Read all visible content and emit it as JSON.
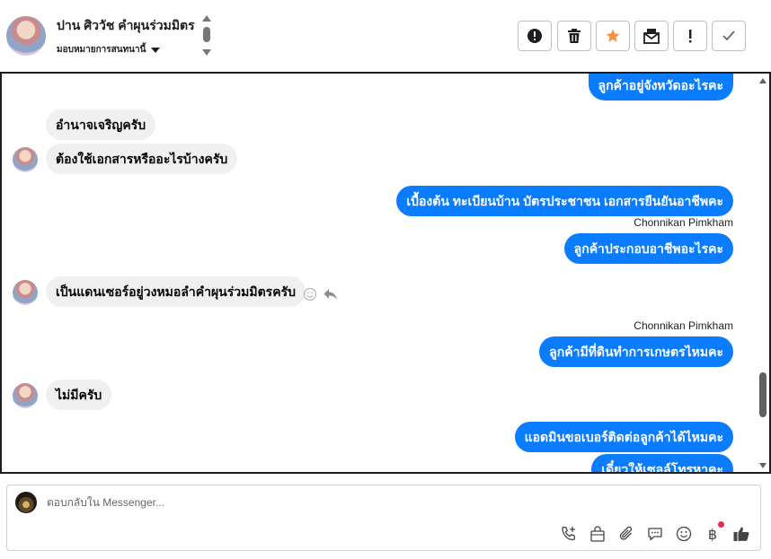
{
  "header": {
    "name": "ปาน ศิววัช คำผุนร่วมมิตร",
    "assign_label": "มอบหมายการสนทนานี้",
    "tools": [
      {
        "name": "report-button",
        "icon": "alert-circle-icon"
      },
      {
        "name": "delete-button",
        "icon": "trash-icon"
      },
      {
        "name": "star-button",
        "icon": "star-icon"
      },
      {
        "name": "mark-unread-button",
        "icon": "envelope-icon"
      },
      {
        "name": "spam-button",
        "icon": "exclamation-icon"
      },
      {
        "name": "done-button",
        "icon": "check-icon"
      }
    ]
  },
  "messages": [
    {
      "side": "out",
      "text": "ลูกค้าอยู่จังหวัดอะไรคะ"
    },
    {
      "side": "in",
      "text": "อำนาจเจริญครับ"
    },
    {
      "side": "in",
      "text": "ต้องใช้เอกสารหรืออะไรบ้างครับ"
    },
    {
      "side": "out",
      "text": "เบื้องต้น ทะเบียนบ้าน บัตรประชาชน เอกสารยืนยันอาชีพคะ"
    },
    {
      "side": "out",
      "sender": "Chonnikan Pimkham",
      "text": "ลูกค้าประกอบอาชีพอะไรคะ"
    },
    {
      "side": "in",
      "text": "เป็นแดนเซอร์อยู่วงหมอลำคำผุนร่วมมิตรครับ"
    },
    {
      "side": "out",
      "sender": "Chonnikan Pimkham",
      "text": "ลูกค้ามีที่ดินทำการเกษตรไหมคะ"
    },
    {
      "side": "in",
      "text": "ไม่มีครับ"
    },
    {
      "side": "out",
      "text": "แอดมินขอเบอร์ติดต่อลูกค้าได้ไหมคะ"
    },
    {
      "side": "out",
      "text": "เดี๋ยวให้เซลล์โทรหาคะ"
    }
  ],
  "composer": {
    "placeholder": "ตอบกลับใน Messenger...",
    "icons": [
      "call-add-icon",
      "shopping-bag-icon",
      "paperclip-icon",
      "saved-reply-icon",
      "emoji-icon",
      "baht-payment-icon",
      "like-icon"
    ],
    "baht_symbol": "฿"
  },
  "colors": {
    "outgoing_bubble": "#0a7cff",
    "incoming_bubble": "#f0f0f0",
    "star": "#f7923b",
    "notification_dot": "#f02849"
  }
}
